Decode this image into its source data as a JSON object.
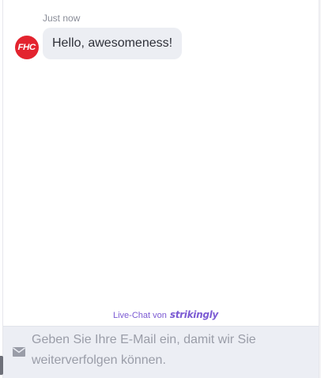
{
  "chat": {
    "timestamp": "Just now",
    "avatar_logo": "FHC",
    "messages": [
      {
        "text": "Hello, awesomeness!"
      }
    ]
  },
  "footer": {
    "powered_by_prefix": "Live-Chat von",
    "powered_by_brand": "strikingly"
  },
  "email_form": {
    "placeholder": "Geben Sie Ihre E-Mail ein, damit wir Sie weiterverfolgen können.",
    "value": "",
    "icon": "mail-icon"
  },
  "colors": {
    "avatar_bg": "#e3232e",
    "bubble_bg": "#eceef3",
    "brand_accent": "#7b5ad3",
    "input_bar_bg": "#eceef4"
  }
}
